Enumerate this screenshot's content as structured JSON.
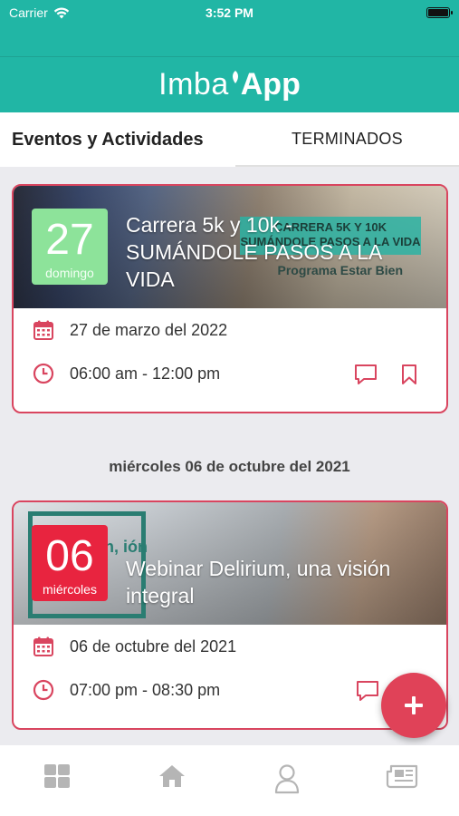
{
  "status_bar": {
    "carrier": "Carrier",
    "time": "3:52 PM"
  },
  "header": {
    "logo_light": "Imba",
    "logo_bold": "App"
  },
  "tabs": {
    "active": "Eventos y Actividades",
    "ended": "TERMINADOS"
  },
  "events": [
    {
      "day": "27",
      "weekday": "domingo",
      "title": "Carrera 5k y 10k - SUMÁNDOLE PASOS A LA VIDA",
      "banner_text": "CARRERA 5K Y 10K SUMÁNDOLE PASOS A LA VIDA",
      "banner_subtitle": "Programa Estar Bien",
      "date": "27 de marzo del 2022",
      "time": "06:00 am - 12:00 pm",
      "badge_color": "#8de39a"
    },
    {
      "day": "06",
      "weekday": "miércoles",
      "title": "Webinar Delirium, una visión integral",
      "banner_text": "n, ión",
      "date": "06 de octubre del 2021",
      "time": "07:00 pm - 08:30 pm",
      "badge_color": "#e8243f"
    }
  ],
  "section_date": "miércoles 06 de octubre del 2021",
  "colors": {
    "teal": "#21b6a5",
    "accent_red": "#d9455f"
  },
  "icons": {
    "calendar": "calendar-icon",
    "clock": "clock-icon",
    "comment": "comment-icon",
    "bookmark": "bookmark-icon",
    "add": "plus-icon",
    "nav": [
      "grid-icon",
      "home-icon",
      "user-icon",
      "news-icon"
    ]
  }
}
